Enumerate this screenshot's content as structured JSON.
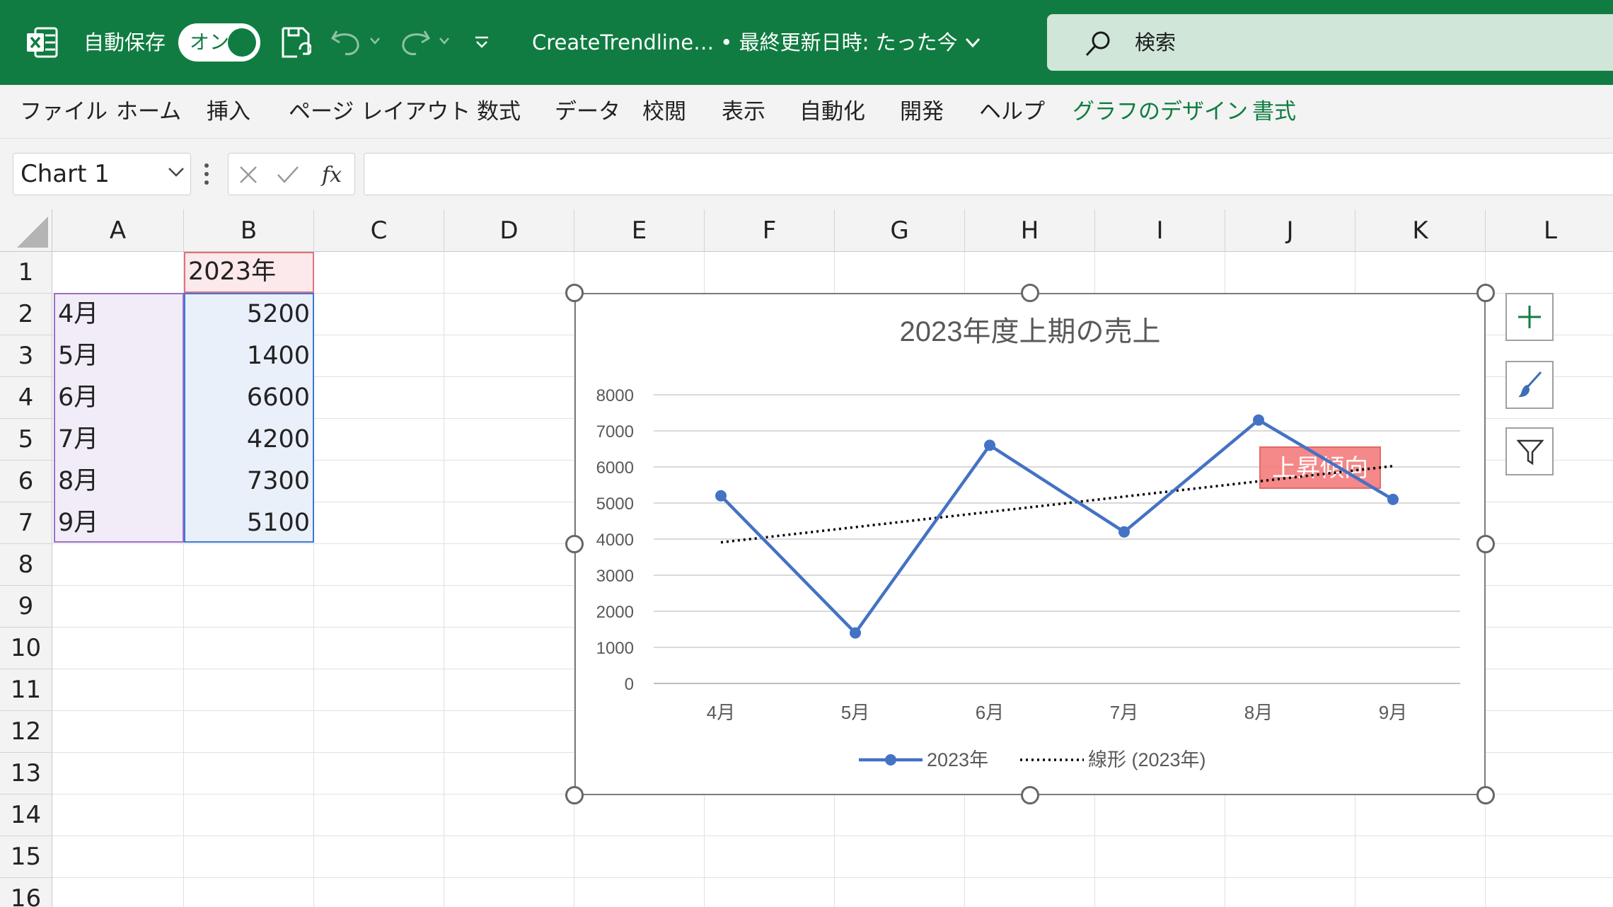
{
  "titlebar": {
    "autosave_label": "自動保存",
    "autosave_state": "オン",
    "doc_title": "CreateTrendline… • 最終更新日時: たった今",
    "search_placeholder": "検索"
  },
  "ribbon": {
    "tabs": [
      "ファイル",
      "ホーム",
      "挿入",
      "ページ レイアウト",
      "数式",
      "データ",
      "校閲",
      "表示",
      "自動化",
      "開発",
      "ヘルプ",
      "グラフのデザイン",
      "書式"
    ],
    "contextual_tab_color": "#107c41"
  },
  "formula_bar": {
    "name_box": "Chart 1",
    "formula": ""
  },
  "sheet": {
    "columns": [
      "A",
      "B",
      "C",
      "D",
      "E",
      "F",
      "G",
      "H",
      "I",
      "J",
      "K",
      "L"
    ],
    "rows": [
      "1",
      "2",
      "3",
      "4",
      "5",
      "6",
      "7",
      "8",
      "9",
      "10",
      "11",
      "12",
      "13",
      "14",
      "15",
      "16"
    ],
    "header_cell": "2023年",
    "data": [
      {
        "month": "4月",
        "value": "5200"
      },
      {
        "month": "5月",
        "value": "1400"
      },
      {
        "month": "6月",
        "value": "6600"
      },
      {
        "month": "7月",
        "value": "4200"
      },
      {
        "month": "8月",
        "value": "7300"
      },
      {
        "month": "9月",
        "value": "5100"
      }
    ]
  },
  "chart_data": {
    "type": "line",
    "title": "2023年度上期の売上",
    "categories": [
      "4月",
      "5月",
      "6月",
      "7月",
      "8月",
      "9月"
    ],
    "series": [
      {
        "name": "2023年",
        "values": [
          5200,
          1400,
          6600,
          4200,
          7300,
          5100
        ],
        "color": "#4472c4"
      }
    ],
    "trendline": {
      "name": "線形 (2023年)",
      "type": "linear",
      "style": "dotted",
      "color": "#000000"
    },
    "annotation": "上昇傾向",
    "annotation_color": "#f47c7c",
    "yticks": [
      "0",
      "1000",
      "2000",
      "3000",
      "4000",
      "5000",
      "6000",
      "7000",
      "8000"
    ],
    "ylim": [
      0,
      8000
    ],
    "grid": true,
    "legend_position": "bottom"
  }
}
